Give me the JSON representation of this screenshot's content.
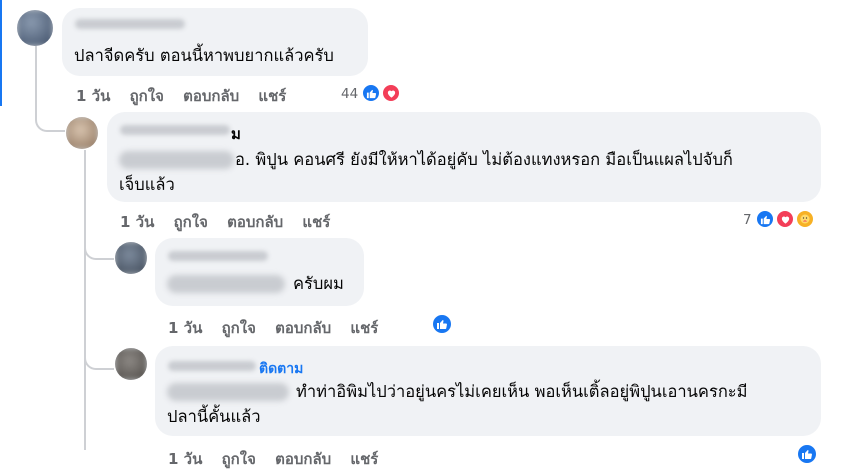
{
  "comments": [
    {
      "text": "ปลาจีดครับ ตอนนี้หาพบยากแล้วครับ",
      "time": "1 วัน",
      "like": "ถูกใจ",
      "reply": "ตอบกลับ",
      "share": "แชร์",
      "reaction_count": "44",
      "reactions": [
        "like-icon",
        "love-icon"
      ]
    },
    {
      "name_suffix": "ม",
      "text_line1": "อ. พิปูน คอนศรี ยังมีให้หาได้อยู่คับ ไม่ต้องแทงหรอก มือเป็นแผลไปจับก็",
      "text_line2": "เจ็บแล้ว",
      "time": "1 วัน",
      "like": "ถูกใจ",
      "reply": "ตอบกลับ",
      "share": "แชร์",
      "reaction_count": "7",
      "reactions": [
        "like-icon",
        "love-icon",
        "care-icon"
      ]
    },
    {
      "text": "ครับผม",
      "time": "1 วัน",
      "like": "ถูกใจ",
      "reply": "ตอบกลับ",
      "share": "แชร์",
      "reactions": [
        "like-icon"
      ]
    },
    {
      "name_link": "ติดตาม",
      "text_line1": "ทำท่าอิพิมไปว่าอยู่นครไม่เคยเห็น พอเห็นเติ้ลอยู่พิปูนเอานครกะมี",
      "text_line2": "ปลานี้คั้นแล้ว",
      "time": "1 วัน",
      "like": "ถูกใจ",
      "reply": "ตอบกลับ",
      "share": "แชร์",
      "reactions": [
        "like-icon"
      ]
    }
  ],
  "colors": {
    "bubble": "#f0f2f5",
    "like": "#1877f2",
    "love": "#f33e58",
    "care": "#f7b125",
    "meta": "#65676b"
  }
}
